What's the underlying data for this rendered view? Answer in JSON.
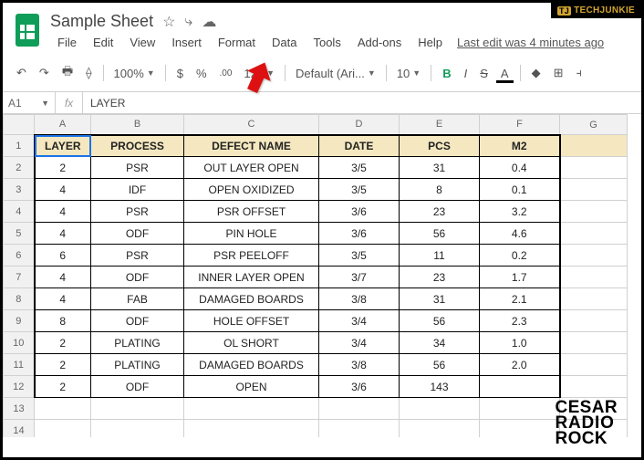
{
  "doc": {
    "title": "Sample Sheet"
  },
  "menus": {
    "file": "File",
    "edit": "Edit",
    "view": "View",
    "insert": "Insert",
    "format": "Format",
    "data": "Data",
    "tools": "Tools",
    "addons": "Add-ons",
    "help": "Help",
    "lastedit": "Last edit was 4 minutes ago"
  },
  "toolbar": {
    "zoom": "100%",
    "dollar": "$",
    "percent": "%",
    "decfmt": ".00",
    "numfmt": "123",
    "font": "Default (Ari...",
    "size": "10",
    "bold": "B",
    "italic": "I",
    "strike": "S",
    "underlineA": "A"
  },
  "namebox": "A1",
  "fxvalue": "LAYER",
  "cols": [
    "A",
    "B",
    "C",
    "D",
    "E",
    "F",
    "G"
  ],
  "headers": {
    "layer": "LAYER",
    "process": "PROCESS",
    "defect": "DEFECT NAME",
    "date": "DATE",
    "pcs": "PCS",
    "m2": "M2"
  },
  "rows": [
    {
      "n": "2",
      "layer": "2",
      "process": "PSR",
      "defect": "OUT LAYER OPEN",
      "date": "3/5",
      "pcs": "31",
      "m2": "0.4"
    },
    {
      "n": "3",
      "layer": "4",
      "process": "IDF",
      "defect": "OPEN OXIDIZED",
      "date": "3/5",
      "pcs": "8",
      "m2": "0.1"
    },
    {
      "n": "4",
      "layer": "4",
      "process": "PSR",
      "defect": "PSR OFFSET",
      "date": "3/6",
      "pcs": "23",
      "m2": "3.2"
    },
    {
      "n": "5",
      "layer": "4",
      "process": "ODF",
      "defect": "PIN HOLE",
      "date": "3/6",
      "pcs": "56",
      "m2": "4.6"
    },
    {
      "n": "6",
      "layer": "6",
      "process": "PSR",
      "defect": "PSR PEELOFF",
      "date": "3/5",
      "pcs": "11",
      "m2": "0.2"
    },
    {
      "n": "7",
      "layer": "4",
      "process": "ODF",
      "defect": "INNER LAYER OPEN",
      "date": "3/7",
      "pcs": "23",
      "m2": "1.7"
    },
    {
      "n": "8",
      "layer": "4",
      "process": "FAB",
      "defect": "DAMAGED BOARDS",
      "date": "3/8",
      "pcs": "31",
      "m2": "2.1"
    },
    {
      "n": "9",
      "layer": "8",
      "process": "ODF",
      "defect": "HOLE OFFSET",
      "date": "3/4",
      "pcs": "56",
      "m2": "2.3"
    },
    {
      "n": "10",
      "layer": "2",
      "process": "PLATING",
      "defect": "OL SHORT",
      "date": "3/4",
      "pcs": "34",
      "m2": "1.0"
    },
    {
      "n": "11",
      "layer": "2",
      "process": "PLATING",
      "defect": "DAMAGED BOARDS",
      "date": "3/8",
      "pcs": "56",
      "m2": "2.0"
    },
    {
      "n": "12",
      "layer": "2",
      "process": "ODF",
      "defect": "OPEN",
      "date": "3/6",
      "pcs": "143",
      "m2": ""
    }
  ],
  "emptyrows": [
    "13",
    "14"
  ],
  "badge": {
    "tag": "TJ",
    "name": "TECHJUNKIE"
  },
  "watermark": {
    "l1": "CESAR",
    "l2": "RADIO",
    "l3": "ROCK"
  }
}
